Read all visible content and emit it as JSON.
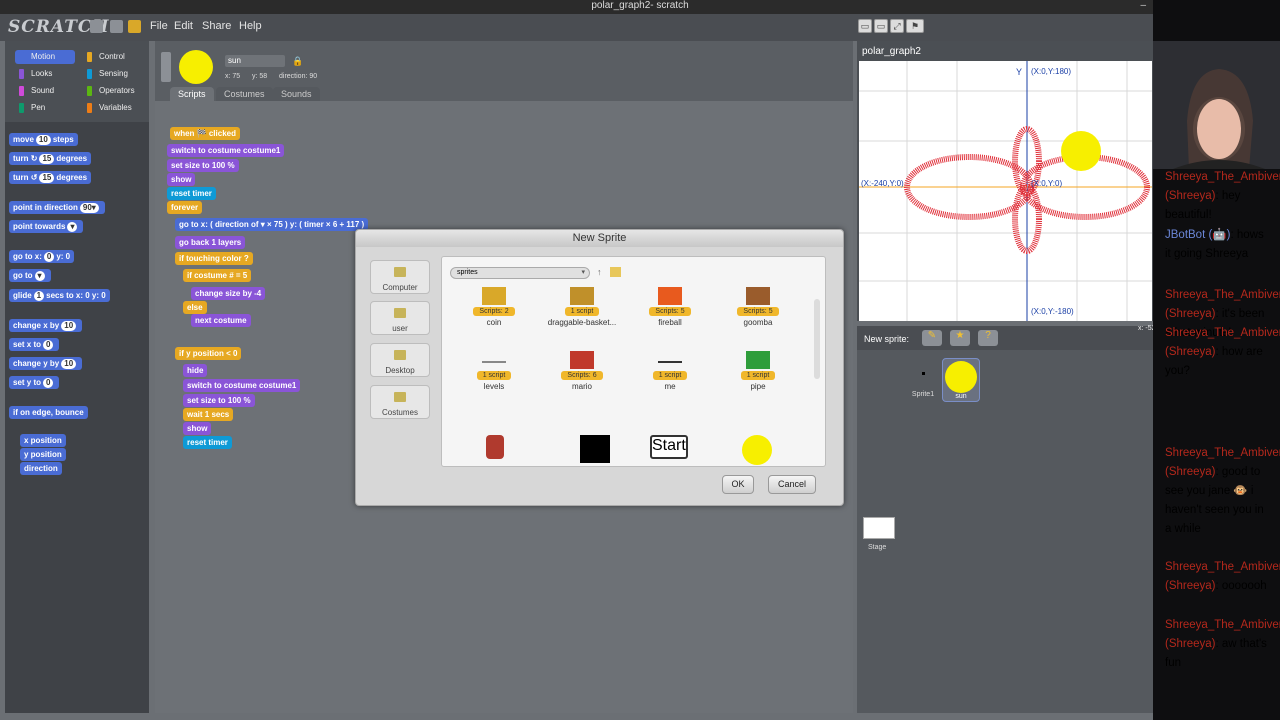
{
  "window": {
    "title": "polar_graph2- scratch",
    "minimize": "–"
  },
  "app": {
    "logo": "SCRATCH"
  },
  "menu": [
    "File",
    "Edit",
    "Share",
    "Help"
  ],
  "categories": [
    {
      "label": "Motion",
      "color": "#4a6cd4"
    },
    {
      "label": "Control",
      "color": "#e6a822"
    },
    {
      "label": "Looks",
      "color": "#8a55d7"
    },
    {
      "label": "Sensing",
      "color": "#0e9ad6"
    },
    {
      "label": "Sound",
      "color": "#cf4ad9"
    },
    {
      "label": "Operators",
      "color": "#5cb712"
    },
    {
      "label": "Pen",
      "color": "#0e9a6c"
    },
    {
      "label": "Variables",
      "color": "#ee7d16"
    }
  ],
  "palette_blocks": [
    {
      "pre": "move",
      "num": "10",
      "post": "steps"
    },
    {
      "pre": "turn ↻",
      "num": "15",
      "post": "degrees"
    },
    {
      "pre": "turn ↺",
      "num": "15",
      "post": "degrees"
    },
    {
      "pre": "point in direction",
      "num": "90▾",
      "post": ""
    },
    {
      "pre": "point towards",
      "num": "▾",
      "post": ""
    },
    {
      "pre": "go to x:",
      "num": "0",
      "post": "y: 0"
    },
    {
      "pre": "go to",
      "num": "▾",
      "post": ""
    },
    {
      "pre": "glide",
      "num": "1",
      "post": "secs to x: 0 y: 0"
    },
    {
      "pre": "change x by",
      "num": "10",
      "post": ""
    },
    {
      "pre": "set x to",
      "num": "0",
      "post": ""
    },
    {
      "pre": "change y by",
      "num": "10",
      "post": ""
    },
    {
      "pre": "set y to",
      "num": "0",
      "post": ""
    },
    {
      "pre": "if on edge, bounce",
      "num": "",
      "post": ""
    },
    {
      "pre": "x position",
      "num": "",
      "post": ""
    },
    {
      "pre": "y position",
      "num": "",
      "post": ""
    },
    {
      "pre": "direction",
      "num": "",
      "post": ""
    }
  ],
  "sprite": {
    "name": "sun",
    "x": "x: 75",
    "y": "y: 58",
    "direction": "direction: 90"
  },
  "tabs": [
    "Scripts",
    "Costumes",
    "Sounds"
  ],
  "script": [
    "when 🏁 clicked",
    "switch to costume costume1",
    "set size to 100 %",
    "show",
    "reset timer",
    "forever",
    "go to x: ( direction of ▾ × 75 ) y: ( timer × 6 + 117 )",
    "go back 1 layers",
    "if touching color ?",
    "if costume # = 5",
    "change size by -4",
    "else",
    "next costume",
    "if y position < 0",
    "hide",
    "switch to costume costume1",
    "set size to 100 %",
    "wait 1 secs",
    "show",
    "reset timer"
  ],
  "dialog": {
    "title": "New Sprite",
    "folder": "sprites",
    "sources": [
      "Computer",
      "user",
      "Desktop",
      "Costumes"
    ],
    "items": [
      {
        "name": "coin",
        "badge": "Scripts: 2"
      },
      {
        "name": "draggable-basket...",
        "badge": "1 script"
      },
      {
        "name": "fireball",
        "badge": "Scripts: 5"
      },
      {
        "name": "goomba",
        "badge": "Scripts: 5"
      },
      {
        "name": "levels",
        "badge": "1 script"
      },
      {
        "name": "mario",
        "badge": "Scripts: 6"
      },
      {
        "name": "me",
        "badge": "1 script"
      },
      {
        "name": "pipe",
        "badge": "1 script"
      }
    ],
    "bottom_thumb_text": "Start",
    "ok": "OK",
    "cancel": "Cancel"
  },
  "stage": {
    "title": "polar_graph2",
    "y_label": "Y",
    "top": "(X:0,Y:180)",
    "bottom": "(X:0,Y:-180)",
    "left": "(X:-240,Y:0)",
    "center": "(X:0,Y:0)",
    "right": "(X:240,Y:0)",
    "coords": "x: -521"
  },
  "sprite_panel": {
    "new_sprite": "New sprite:",
    "sprites": [
      "Sprite1",
      "sun"
    ],
    "stage": "Stage"
  },
  "chat": [
    {
      "name": "Shreeya_The_Ambivert (Shreeya)",
      "text": ": hey beautiful!"
    },
    {
      "name": "JBotBot (🤖)",
      "text": ": hows it going Shreeya"
    },
    {
      "name": "Shreeya_The_Ambivert (Shreeya)",
      "text": ": it's been a hot minute!"
    },
    {
      "name": "Shreeya_The_Ambivert (Shreeya)",
      "text": ": how are you?"
    },
    {
      "name": "Shreeya_The_Ambivert (Shreeya)",
      "text": ": good to see you jane 🐵 i haven't seen you in a while"
    },
    {
      "name": "Shreeya_The_Ambivert (Shreeya)",
      "text": ": ooooooh"
    },
    {
      "name": "Shreeya_The_Ambivert (Shreeya)",
      "text": ": aw that's fun"
    }
  ]
}
